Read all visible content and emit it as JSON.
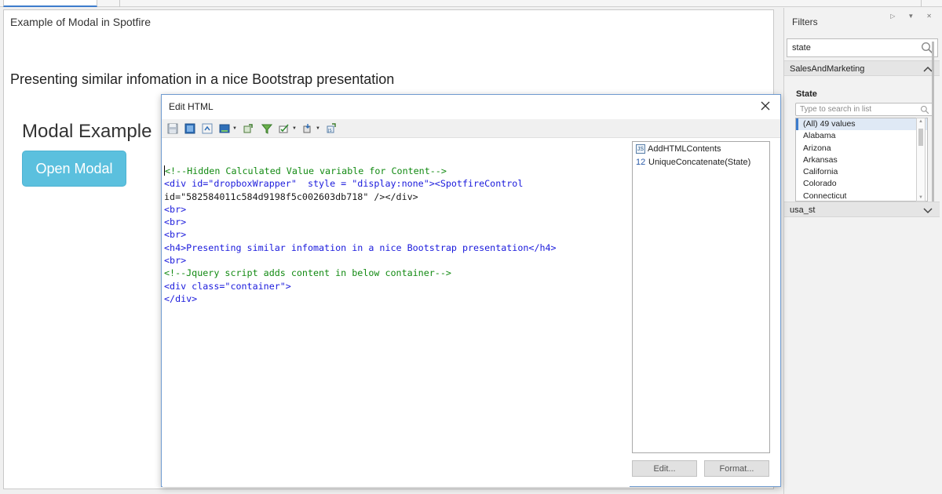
{
  "viz": {
    "title": "Example of Modal in Spotfire",
    "subheading": "Presenting similar infomation in a nice Bootstrap presentation",
    "modal_heading": "Modal Example",
    "open_modal_label": "Open Modal",
    "button_color": "#5bc0de"
  },
  "filters": {
    "title": "Filters",
    "search_value": "state",
    "group1": "SalesAndMarketing",
    "field_label": "State",
    "list_placeholder": "Type to search in list",
    "states": [
      "(All) 49 values",
      "Alabama",
      "Arizona",
      "Arkansas",
      "California",
      "Colorado",
      "Connecticut"
    ],
    "group2": "usa_st"
  },
  "dialog": {
    "title": "Edit HTML",
    "code_lines": [
      "<!--Hidden Calculated Value variable for Content-->",
      "<div id=\"dropboxWrapper\"  style = \"display:none\"><SpotfireControl",
      "id=\"582584011c584d9198f5c002603db718\" /></div>",
      "<br>",
      "<br>",
      "<br>",
      "<h4>Presenting similar infomation in a nice Bootstrap presentation</h4>",
      "<br>",
      "<!--Jquery script adds content in below container-->",
      "<div class=\"container\">",
      "</div>"
    ],
    "side_items": [
      {
        "badge": "JS",
        "label": "AddHTMLContents"
      },
      {
        "badge": "12",
        "label": "UniqueConcatenate(State)"
      }
    ],
    "edit_label": "Edit...",
    "format_label": "Format...",
    "accent_color": "#3d7ccc"
  }
}
